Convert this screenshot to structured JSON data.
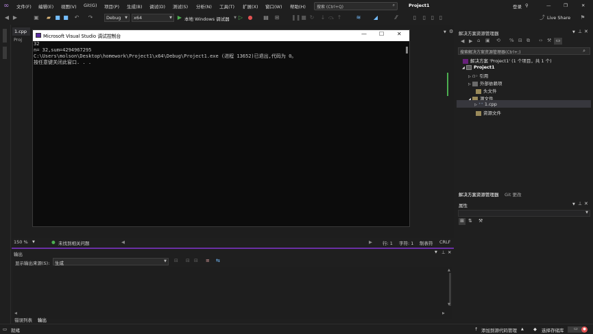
{
  "menu": {
    "items": [
      "文件(F)",
      "编辑(E)",
      "视图(V)",
      "Git(G)",
      "项目(P)",
      "生成(B)",
      "调试(D)",
      "测试(S)",
      "分析(N)",
      "工具(T)",
      "扩展(X)",
      "窗口(W)",
      "帮助(H)"
    ],
    "search_placeholder": "搜索 (Ctrl+Q)",
    "project_name": "Project1",
    "login": "登录",
    "live_share": "Live Share"
  },
  "toolbar": {
    "config": "Debug",
    "platform": "x64",
    "run_label": "本地 Windows 调试器"
  },
  "editor": {
    "tab": "1.cpp",
    "prop_label": "Proj",
    "zoom": "150 %",
    "issues": "未找到相关问题",
    "line": "行: 1",
    "char": "字符: 1",
    "tabs": "制表符",
    "eol": "CRLF"
  },
  "console": {
    "title": "Microsoft Visual Studio 调试控制台",
    "lines": [
      "32",
      "n= 32,sum=4294967295",
      "C:\\Users\\molson\\Desktop\\homework\\Project1\\x64\\Debug\\Project1.exe (进程 13652)已退出,代码为 0。",
      "按任意键关闭此窗口. . ."
    ]
  },
  "output": {
    "title": "输出",
    "source_label": "显示输出来源(S):",
    "source_value": "生成"
  },
  "bottom_tabs": [
    "错误列表",
    "输出"
  ],
  "solution_explorer": {
    "title": "解决方案资源管理器",
    "search_placeholder": "搜索解决方案资源管理器(Ctrl+;)",
    "solution": "解决方案 'Project1' (1 个项目，共 1 个)",
    "project": "Project1",
    "nodes": [
      "引用",
      "外部依赖项",
      "头文件",
      "源文件",
      "1.cpp",
      "资源文件"
    ],
    "tabs": [
      "解决方案资源管理器",
      "Git 更改"
    ]
  },
  "properties": {
    "title": "属性"
  },
  "status": {
    "ready": "就绪",
    "add_source": "添加到源代码管理",
    "select_repo": "选择存储库"
  },
  "colors": {
    "accent": "#6b2fa5",
    "green": "#4caf50"
  }
}
